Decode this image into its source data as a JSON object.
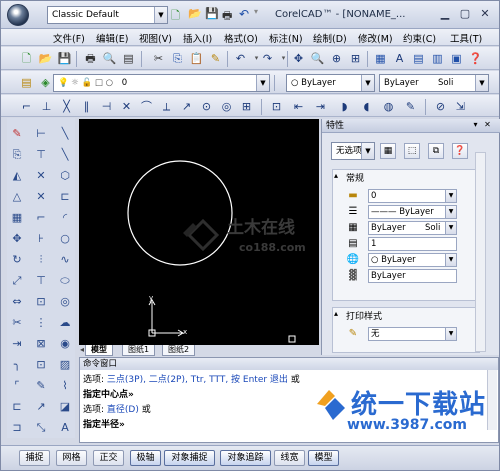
{
  "titlebar": {
    "workspace": "Classic Default",
    "title": "CorelCAD™ - [NONAME_..."
  },
  "menubar": {
    "items": [
      "文件(F)",
      "编辑(E)",
      "视图(V)",
      "插入(I)",
      "格式(O)",
      "标注(N)",
      "绘制(D)",
      "修改(M)",
      "约束(C)",
      "工具(T)"
    ]
  },
  "layer_toolbar": {
    "layer_value": "0"
  },
  "prop_toolbar": {
    "color": "ByLayer",
    "linetype": "ByLayer",
    "lineweight": "Soli"
  },
  "canvas": {
    "watermark_cn": "土木在线",
    "watermark_url": "co188.com",
    "ucs_x": "x",
    "ucs_y": "y"
  },
  "tabs": [
    "模型",
    "图纸1",
    "图纸2"
  ],
  "properties": {
    "title": "特性",
    "selection": "无选项",
    "general_title": "常规",
    "color_val": "0",
    "linetype_val": "——— ByLayer",
    "lineweight_val": "ByLayer",
    "lineweight_style": "Soli",
    "scale_val": "1",
    "plotstyle_val": "○ ByLayer",
    "material_val": "ByLayer",
    "print_title": "打印样式",
    "print_val": "无"
  },
  "command": {
    "title": "命令窗口",
    "line1_prefix": "选项: ",
    "line1_opts": "三点(3P), 二点(2P), Ttr, TTT, 按 Enter 退出",
    "line1_suffix": " 或",
    "line2": "指定中心点»",
    "line3_prefix": "选项: ",
    "line3_opt": "直径(D)",
    "line3_suffix": " 或",
    "line4": "指定半径»"
  },
  "statusbar": {
    "buttons": [
      "捕捉",
      "网格",
      "正交",
      "极轴",
      "对象捕捉",
      "对象追踪",
      "线宽",
      "模型"
    ],
    "active": [
      false,
      false,
      false,
      true,
      true,
      true,
      false,
      true
    ]
  },
  "watermark": {
    "logo": "统一下载站",
    "url": "www.3987.com"
  }
}
